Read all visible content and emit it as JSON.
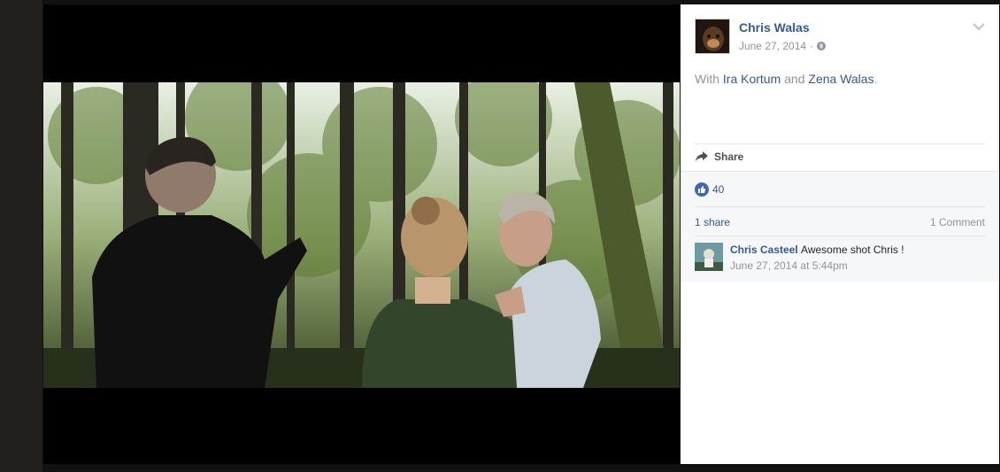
{
  "post": {
    "author": "Chris Walas",
    "date": "June 27, 2014",
    "date_sep": "·",
    "privacy_icon": "globe-icon",
    "with_prefix": "With",
    "tagged": [
      "Ira Kortum",
      "Zena Walas"
    ],
    "tag_joiner": "and",
    "tag_end": "."
  },
  "actions": {
    "share_label": "Share"
  },
  "stats": {
    "likes_count": "40",
    "shares_text": "1 share",
    "comments_text": "1 Comment"
  },
  "comment": {
    "author": "Chris Casteel",
    "text": "Awesome shot Chris !",
    "time": "June 27, 2014 at 5:44pm"
  },
  "colors": {
    "link": "#365899",
    "meta": "#90949c",
    "like_blue": "#4267b2"
  }
}
